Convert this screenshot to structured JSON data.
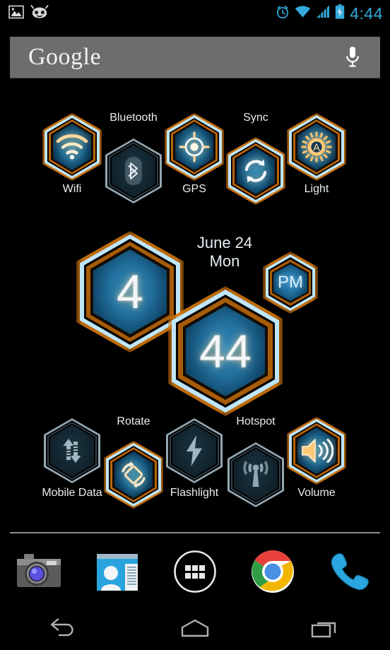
{
  "statusbar": {
    "left_icons": [
      {
        "name": "screenshot-image-icon",
        "label": "Screenshot"
      },
      {
        "name": "cyanogenmod-icon",
        "label": "CyanogenMod"
      }
    ],
    "right_icons": [
      {
        "name": "alarm-clock-icon",
        "label": "Alarm set"
      },
      {
        "name": "wifi-signal-icon",
        "label": "Wi-Fi"
      },
      {
        "name": "cellular-signal-icon",
        "label": "Signal"
      },
      {
        "name": "battery-charging-icon",
        "label": "Battery charging"
      }
    ],
    "clock": "4:44",
    "accent_color": "#33a9dc"
  },
  "search": {
    "logo_text": "Google",
    "mic_icon": "microphone-icon",
    "background_color": "#6d6d6d"
  },
  "toggles": {
    "active_ring_color": "#bfe6fb",
    "active_glow_color": "#d2760d",
    "inactive_ring_color": "#93a7b2",
    "top_row": [
      {
        "id": "wifi",
        "label": "Wifi",
        "icon": "wifi-icon",
        "state": "on",
        "label_pos": "below"
      },
      {
        "id": "bluetooth",
        "label": "Bluetooth",
        "icon": "bluetooth-icon",
        "state": "off",
        "label_pos": "above"
      },
      {
        "id": "gps",
        "label": "GPS",
        "icon": "gps-icon",
        "state": "on",
        "label_pos": "below"
      },
      {
        "id": "sync",
        "label": "Sync",
        "icon": "sync-icon",
        "state": "on",
        "label_pos": "above"
      },
      {
        "id": "light",
        "label": "Light",
        "icon": "auto-brightness-icon",
        "state": "on",
        "label_pos": "below"
      }
    ],
    "bottom_row": [
      {
        "id": "mobiledata",
        "label": "Mobile Data",
        "icon": "mobile-data-icon",
        "state": "off",
        "label_pos": "below"
      },
      {
        "id": "rotate",
        "label": "Rotate",
        "icon": "auto-rotate-icon",
        "state": "on",
        "label_pos": "above"
      },
      {
        "id": "flashlight",
        "label": "Flashlight",
        "icon": "flashlight-icon",
        "state": "off",
        "label_pos": "below"
      },
      {
        "id": "hotspot",
        "label": "Hotspot",
        "icon": "hotspot-icon",
        "state": "off",
        "label_pos": "above"
      },
      {
        "id": "volume",
        "label": "Volume",
        "icon": "volume-icon",
        "state": "on",
        "label_pos": "below"
      }
    ]
  },
  "clock_widget": {
    "hour": "4",
    "minute": "44",
    "meridiem": "PM",
    "date": "June 24",
    "weekday": "Mon"
  },
  "dock": [
    {
      "id": "camera",
      "label": "Camera",
      "icon": "camera-icon"
    },
    {
      "id": "people",
      "label": "People",
      "icon": "contacts-icon"
    },
    {
      "id": "app-drawer",
      "label": "Apps",
      "icon": "app-drawer-icon"
    },
    {
      "id": "chrome",
      "label": "Chrome",
      "icon": "chrome-icon"
    },
    {
      "id": "phone",
      "label": "Phone",
      "icon": "phone-icon"
    }
  ],
  "navbar": [
    {
      "id": "back",
      "label": "Back",
      "icon": "back-arrow-icon"
    },
    {
      "id": "home",
      "label": "Home",
      "icon": "home-icon"
    },
    {
      "id": "recents",
      "label": "Recents",
      "icon": "recents-icon"
    }
  ]
}
